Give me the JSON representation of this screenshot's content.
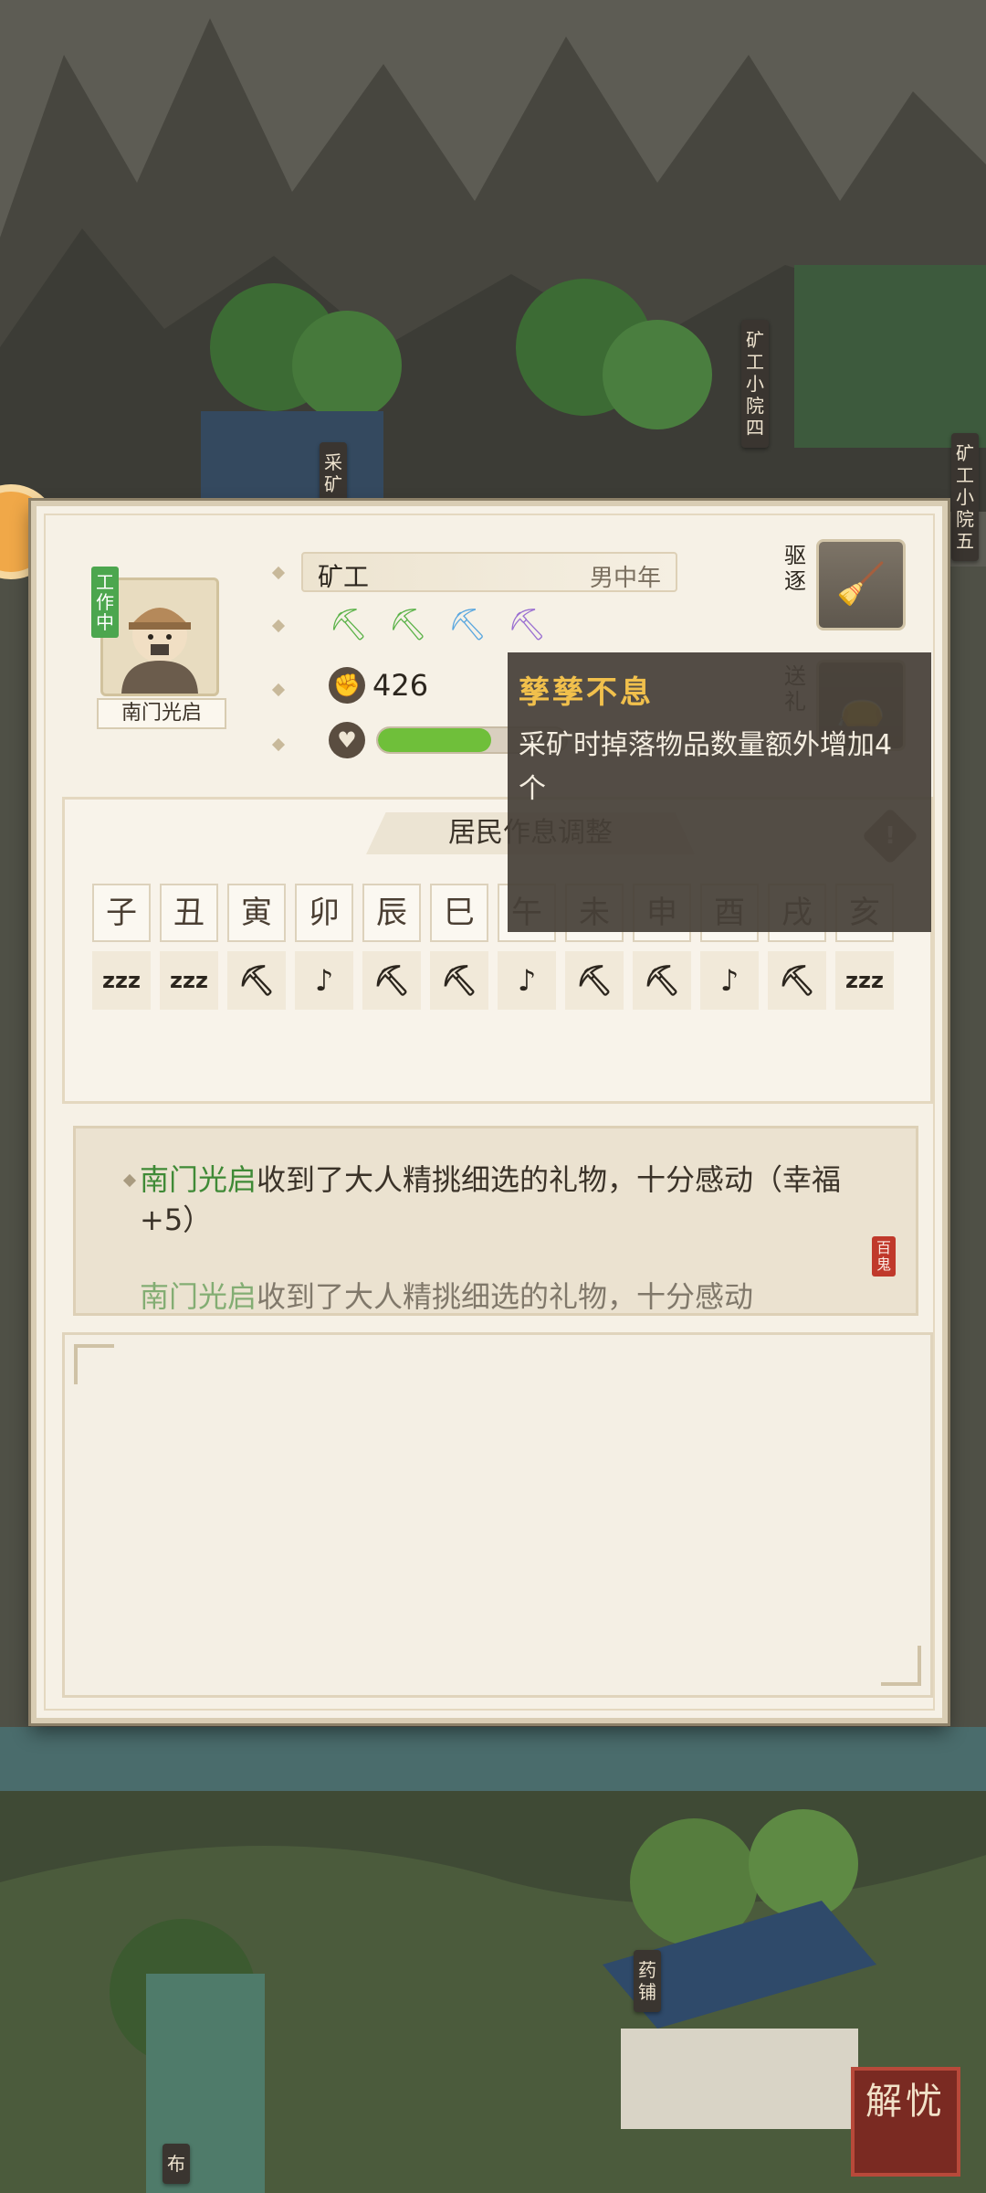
{
  "map": {
    "signs": [
      "采矿",
      "矿工小院四",
      "矿工小院五",
      "药铺",
      "布"
    ],
    "jieyou_label": "解忧"
  },
  "resident": {
    "status_tag": "工作中",
    "name": "南门光启",
    "job": "矿工",
    "demographic": "男中年",
    "trait_icons": [
      "green-pickaxe-icon",
      "green-pickaxe-icon",
      "blue-pickaxe-icon",
      "purple-pickaxe-icon"
    ],
    "stat_value": "426",
    "happiness_fraction": 0.6
  },
  "buttons": {
    "expel_label": "驱逐",
    "gift_label": "送礼"
  },
  "tooltip": {
    "title": "孳孳不息",
    "description": "采矿时掉落物品数量额外增加4个"
  },
  "schedule": {
    "title": "居民作息调整",
    "hours": [
      "子",
      "丑",
      "寅",
      "卯",
      "辰",
      "巳",
      "午",
      "未",
      "申",
      "酉",
      "戌",
      "亥"
    ],
    "activities": [
      "zzz",
      "zzz",
      "⛏",
      "♪",
      "⛏",
      "⛏",
      "♪",
      "⛏",
      "⛏",
      "♪",
      "⛏",
      "zzz"
    ]
  },
  "log": {
    "entries": [
      {
        "who": "南门光启",
        "text": "收到了大人精挑细选的礼物，十分感动（幸福+5）"
      },
      {
        "who": "南门光启",
        "text": "收到了大人精挑细选的礼物，十分感动"
      }
    ],
    "stamp": "百鬼"
  },
  "colors": {
    "accent_green": "#4ca64e",
    "tooltip_title": "#f1c04c",
    "happiness_bar": "#6fbf3a"
  }
}
